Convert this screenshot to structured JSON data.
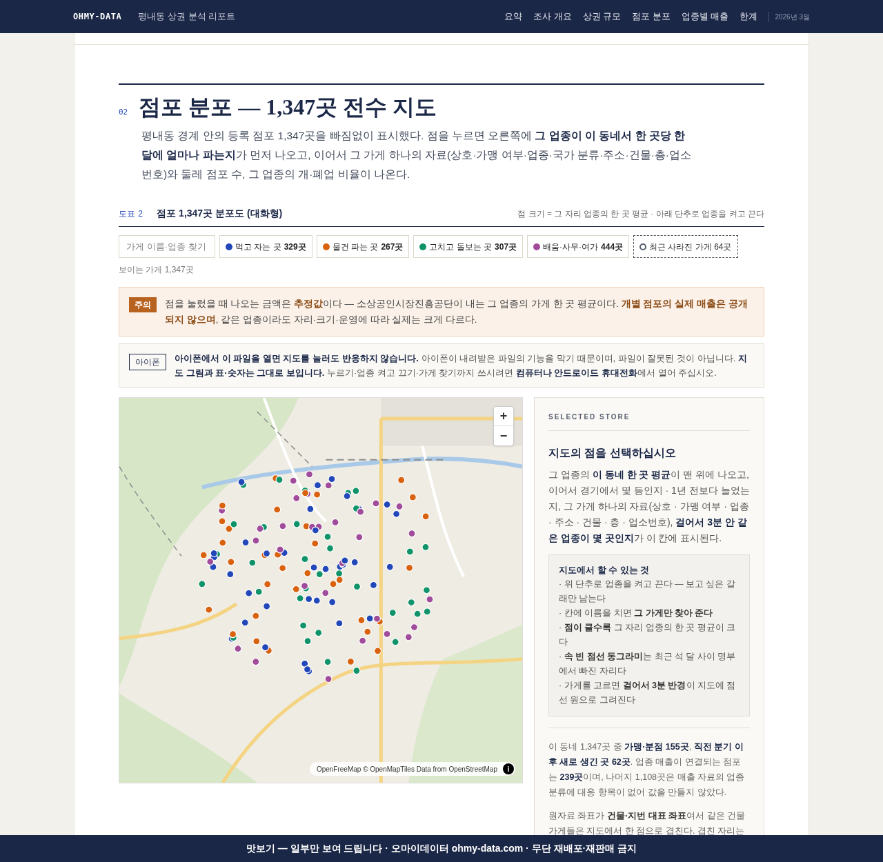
{
  "header": {
    "brand": "OHMY-DATA",
    "report_title": "평내동 상권 분석 리포트",
    "nav": [
      {
        "label": "요약",
        "selected": false
      },
      {
        "label": "조사 개요",
        "selected": false
      },
      {
        "label": "상권 규모",
        "selected": false
      },
      {
        "label": "점포 분포",
        "selected": false
      },
      {
        "label": "업종별 매출",
        "selected": false
      },
      {
        "label": "한계",
        "selected": false
      }
    ],
    "date": "2026년 3월"
  },
  "section": {
    "number": "02",
    "title": "점포 분포 — 1,347곳 전수 지도",
    "lead": "평내동 경계 안의 등록 점포 1,347곳을 빠짐없이 표시했다. 점을 누르면 오른쪽에 **그 업종이 이 동네서 한 곳당 한 달에 얼마나 파는지**가 먼저 나오고, 이어서 그 가게 하나의 자료(상호·가맹 여부·업종·국가 분류·주소·건물·층·업소번호)와 둘레 점포 수, 그 업종의 개·폐업 비율이 나온다."
  },
  "figure": {
    "label": "도표 2",
    "title": "점포 1,347곳 분포도 (대화형)",
    "note": "점 크기 = 그 자리 업종의 한 곳 평균 · 아래 단추로 업종을 켜고 끈다"
  },
  "search": {
    "placeholder": "가게 이름·업종 찾기"
  },
  "filters": [
    {
      "kind": "category",
      "label": "먹고 자는 곳",
      "count": "329곳",
      "color": "#2247b8"
    },
    {
      "kind": "category",
      "label": "물건 파는 곳",
      "count": "267곳",
      "color": "#d9620f"
    },
    {
      "kind": "category",
      "label": "고치고 돌보는 곳",
      "count": "307곳",
      "color": "#11936a"
    },
    {
      "kind": "category",
      "label": "배움·사무·여가",
      "count": "444곳",
      "color": "#a04c9a"
    },
    {
      "kind": "closed",
      "label": "최근 사라진 가게 64곳",
      "color": "#555e6e"
    }
  ],
  "visible_count": "보이는 가게 1,347곳",
  "caution": {
    "badge": "주의",
    "text": "점을 눌렀을 때 나오는 금액은 **추정값**이다 — 소상공인시장진흥공단이 내는 그 업종의 가게 한 곳 평균이다. **개별 점포의 실제 매출은 공개되지 않으며**, 같은 업종이라도 자리·크기·운영에 따라 실제는 크게 다르다."
  },
  "iphone_note": {
    "badge": "아이폰",
    "text": "**아이폰에서 이 파일을 열면 지도를 눌러도 반응하지 않습니다.** 아이폰이 내려받은 파일의 기능을 막기 때문이며, 파일이 잘못된 것이 아닙니다. **지도 그림과 표·숫자는 그대로 보입니다.** 누르기·업종 켜고 끄기·가게 찾기까지 쓰시려면 **컴퓨터나 안드로이드 휴대전화**에서 열어 주십시오."
  },
  "map": {
    "kind": "picture",
    "zoom_in": "+",
    "zoom_out": "−",
    "attribution": "OpenFreeMap © OpenMapTiles Data from OpenStreetMap",
    "info": "i"
  },
  "panel": {
    "eyebrow": "SELECTED STORE",
    "title": "지도의 점을 선택하십시오",
    "intro": "그 업종의 **이 동네 한 곳 평균**이 맨 위에 나오고, 이어서 경기에서 몇 등인지 · 1년 전보다 늘었는지, 그 가게 하나의 자료(상호 · 가맹 여부 · 업종 · 주소 · 건물 · 층 · 업소번호), **걸어서 3분 안 같은 업종이 몇 곳인지**가 이 칸에 표시된다.",
    "tips_title": "지도에서 할 수 있는 것",
    "tips": [
      "· 위 단추로 업종을 켜고 끈다 — 보고 싶은 갈래만 남는다",
      "· 칸에 이름을 치면 **그 가게만 찾아 준다**",
      "· **점이 클수록** 그 자리 업종의 한 곳 평균이 크다",
      "· **속 빈 점선 동그라미**는 최근 석 달 사이 명부에서 빠진 자리다",
      "· 가게를 고르면 **걸어서 3분 반경**이 지도에 점선 원으로 그려진다"
    ],
    "stats": "이 동네 1,347곳 중 **가맹·분점 155곳**, **직전 분기 이후 새로 생긴 곳 62곳**. 업종 매출이 연결되는 점포는 **239곳**이며, 나머지 1,108곳은 매출 자료의 업종 분류에 대응 항목이 없어 값을 만들지 않았다.",
    "coords": "원자료 좌표가 **건물·지번 대표 좌표**여서 같은 건물 가게들은 지도에서 한 점으로 겹친다. 겹친 자리는"
  },
  "footer": "맛보기 — 일부만 보여 드립니다 · 오마이데이터 ohmy-data.com · 무단 재배포·재판매 금지"
}
